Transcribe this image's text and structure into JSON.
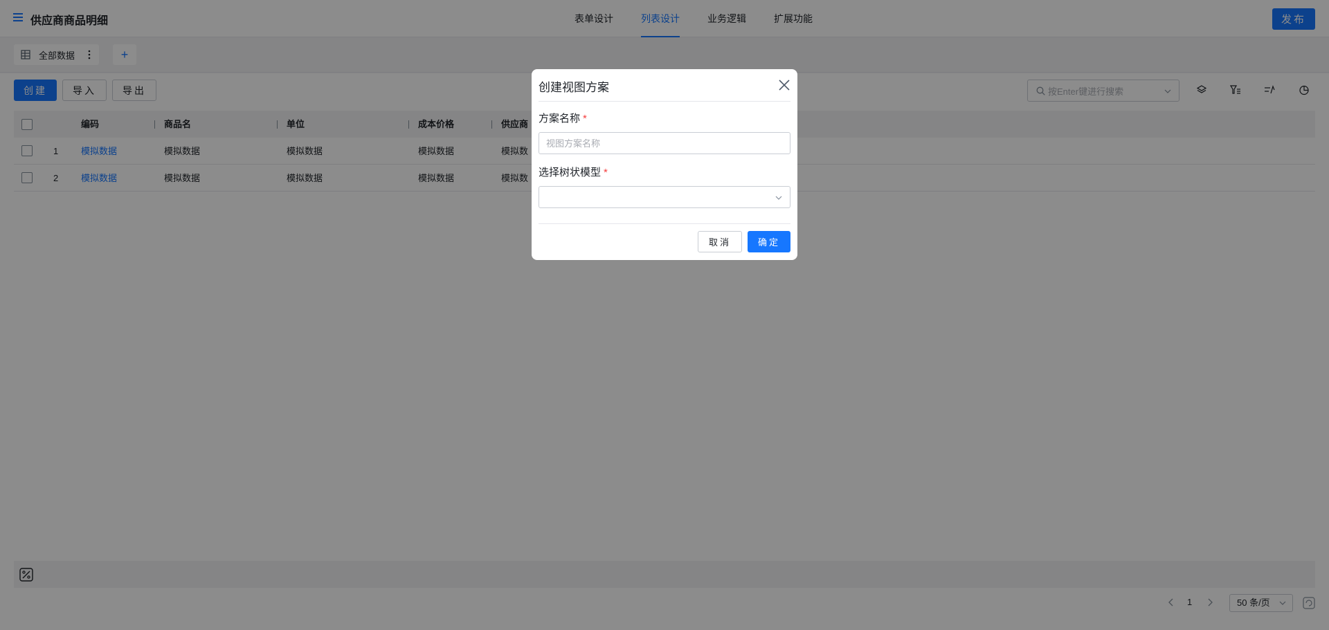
{
  "header": {
    "title": "供应商商品明细",
    "tabs": [
      {
        "label": "表单设计"
      },
      {
        "label": "列表设计"
      },
      {
        "label": "业务逻辑"
      },
      {
        "label": "扩展功能"
      }
    ],
    "active_tab": "列表设计",
    "publish_label": "发布"
  },
  "views": {
    "current_view_label": "全部数据",
    "add_view_label": "+"
  },
  "toolbar": {
    "create_label": "创建",
    "import_label": "导入",
    "export_label": "导出",
    "search_placeholder": "按Enter键进行搜索"
  },
  "table": {
    "columns": [
      "编码",
      "商品名",
      "单位",
      "成本价格",
      "供应商"
    ],
    "rows": [
      {
        "index": "1",
        "code": "模拟数据",
        "name": "模拟数据",
        "unit": "模拟数据",
        "cost": "模拟数据",
        "supplier": "模拟数"
      },
      {
        "index": "2",
        "code": "模拟数据",
        "name": "模拟数据",
        "unit": "模拟数据",
        "cost": "模拟数据",
        "supplier": "模拟数"
      }
    ]
  },
  "pagination": {
    "current_page": "1",
    "page_size_label": "50 条/页"
  },
  "modal": {
    "title": "创建视图方案",
    "field_name_label": "方案名称",
    "field_name_placeholder": "视图方案名称",
    "field_tree_label": "选择树状模型",
    "required_mark": "*",
    "cancel_label": "取消",
    "ok_label": "确定"
  },
  "colors": {
    "primary": "#1677ff",
    "required": "#f53f3f",
    "mask": "rgba(0,0,0,0.45)"
  }
}
